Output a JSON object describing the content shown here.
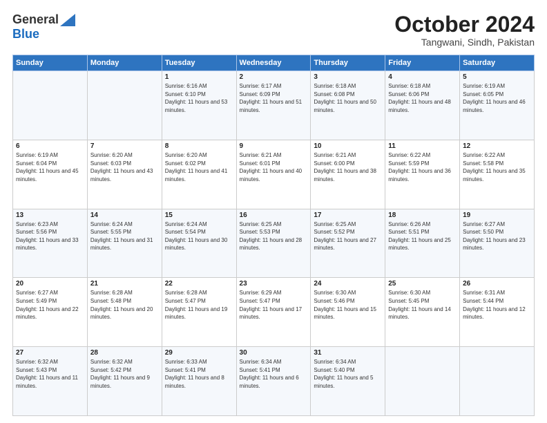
{
  "header": {
    "logo_general": "General",
    "logo_blue": "Blue",
    "month_title": "October 2024",
    "subtitle": "Tangwani, Sindh, Pakistan"
  },
  "weekdays": [
    "Sunday",
    "Monday",
    "Tuesday",
    "Wednesday",
    "Thursday",
    "Friday",
    "Saturday"
  ],
  "weeks": [
    [
      {
        "day": "",
        "info": ""
      },
      {
        "day": "",
        "info": ""
      },
      {
        "day": "1",
        "info": "Sunrise: 6:16 AM\nSunset: 6:10 PM\nDaylight: 11 hours and 53 minutes."
      },
      {
        "day": "2",
        "info": "Sunrise: 6:17 AM\nSunset: 6:09 PM\nDaylight: 11 hours and 51 minutes."
      },
      {
        "day": "3",
        "info": "Sunrise: 6:18 AM\nSunset: 6:08 PM\nDaylight: 11 hours and 50 minutes."
      },
      {
        "day": "4",
        "info": "Sunrise: 6:18 AM\nSunset: 6:06 PM\nDaylight: 11 hours and 48 minutes."
      },
      {
        "day": "5",
        "info": "Sunrise: 6:19 AM\nSunset: 6:05 PM\nDaylight: 11 hours and 46 minutes."
      }
    ],
    [
      {
        "day": "6",
        "info": "Sunrise: 6:19 AM\nSunset: 6:04 PM\nDaylight: 11 hours and 45 minutes."
      },
      {
        "day": "7",
        "info": "Sunrise: 6:20 AM\nSunset: 6:03 PM\nDaylight: 11 hours and 43 minutes."
      },
      {
        "day": "8",
        "info": "Sunrise: 6:20 AM\nSunset: 6:02 PM\nDaylight: 11 hours and 41 minutes."
      },
      {
        "day": "9",
        "info": "Sunrise: 6:21 AM\nSunset: 6:01 PM\nDaylight: 11 hours and 40 minutes."
      },
      {
        "day": "10",
        "info": "Sunrise: 6:21 AM\nSunset: 6:00 PM\nDaylight: 11 hours and 38 minutes."
      },
      {
        "day": "11",
        "info": "Sunrise: 6:22 AM\nSunset: 5:59 PM\nDaylight: 11 hours and 36 minutes."
      },
      {
        "day": "12",
        "info": "Sunrise: 6:22 AM\nSunset: 5:58 PM\nDaylight: 11 hours and 35 minutes."
      }
    ],
    [
      {
        "day": "13",
        "info": "Sunrise: 6:23 AM\nSunset: 5:56 PM\nDaylight: 11 hours and 33 minutes."
      },
      {
        "day": "14",
        "info": "Sunrise: 6:24 AM\nSunset: 5:55 PM\nDaylight: 11 hours and 31 minutes."
      },
      {
        "day": "15",
        "info": "Sunrise: 6:24 AM\nSunset: 5:54 PM\nDaylight: 11 hours and 30 minutes."
      },
      {
        "day": "16",
        "info": "Sunrise: 6:25 AM\nSunset: 5:53 PM\nDaylight: 11 hours and 28 minutes."
      },
      {
        "day": "17",
        "info": "Sunrise: 6:25 AM\nSunset: 5:52 PM\nDaylight: 11 hours and 27 minutes."
      },
      {
        "day": "18",
        "info": "Sunrise: 6:26 AM\nSunset: 5:51 PM\nDaylight: 11 hours and 25 minutes."
      },
      {
        "day": "19",
        "info": "Sunrise: 6:27 AM\nSunset: 5:50 PM\nDaylight: 11 hours and 23 minutes."
      }
    ],
    [
      {
        "day": "20",
        "info": "Sunrise: 6:27 AM\nSunset: 5:49 PM\nDaylight: 11 hours and 22 minutes."
      },
      {
        "day": "21",
        "info": "Sunrise: 6:28 AM\nSunset: 5:48 PM\nDaylight: 11 hours and 20 minutes."
      },
      {
        "day": "22",
        "info": "Sunrise: 6:28 AM\nSunset: 5:47 PM\nDaylight: 11 hours and 19 minutes."
      },
      {
        "day": "23",
        "info": "Sunrise: 6:29 AM\nSunset: 5:47 PM\nDaylight: 11 hours and 17 minutes."
      },
      {
        "day": "24",
        "info": "Sunrise: 6:30 AM\nSunset: 5:46 PM\nDaylight: 11 hours and 15 minutes."
      },
      {
        "day": "25",
        "info": "Sunrise: 6:30 AM\nSunset: 5:45 PM\nDaylight: 11 hours and 14 minutes."
      },
      {
        "day": "26",
        "info": "Sunrise: 6:31 AM\nSunset: 5:44 PM\nDaylight: 11 hours and 12 minutes."
      }
    ],
    [
      {
        "day": "27",
        "info": "Sunrise: 6:32 AM\nSunset: 5:43 PM\nDaylight: 11 hours and 11 minutes."
      },
      {
        "day": "28",
        "info": "Sunrise: 6:32 AM\nSunset: 5:42 PM\nDaylight: 11 hours and 9 minutes."
      },
      {
        "day": "29",
        "info": "Sunrise: 6:33 AM\nSunset: 5:41 PM\nDaylight: 11 hours and 8 minutes."
      },
      {
        "day": "30",
        "info": "Sunrise: 6:34 AM\nSunset: 5:41 PM\nDaylight: 11 hours and 6 minutes."
      },
      {
        "day": "31",
        "info": "Sunrise: 6:34 AM\nSunset: 5:40 PM\nDaylight: 11 hours and 5 minutes."
      },
      {
        "day": "",
        "info": ""
      },
      {
        "day": "",
        "info": ""
      }
    ]
  ]
}
